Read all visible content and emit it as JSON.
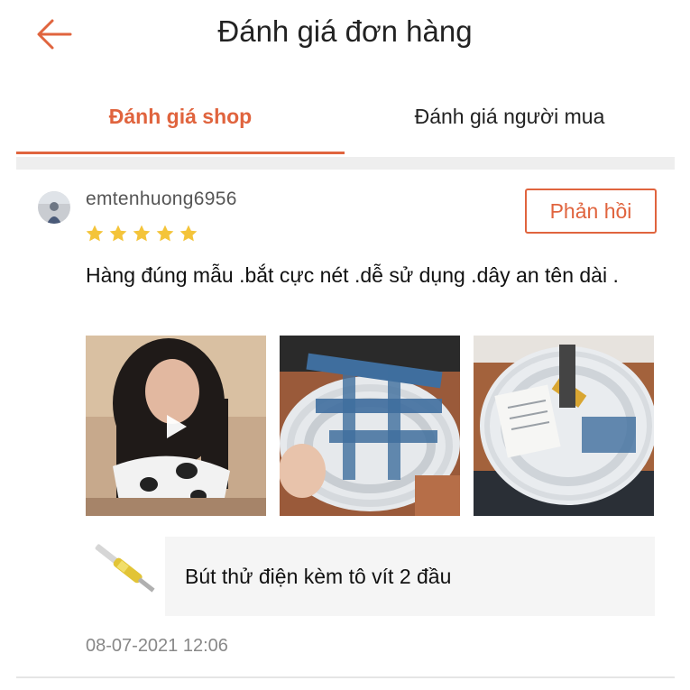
{
  "header": {
    "title": "Đánh giá đơn hàng",
    "back_icon": "arrow-left-icon",
    "accent_color": "#e0643e"
  },
  "tabs": [
    {
      "label": "Đánh giá shop",
      "active": true
    },
    {
      "label": "Đánh giá người mua",
      "active": false
    }
  ],
  "review": {
    "username": "emtenhuong6956",
    "rating": 5,
    "max_rating": 5,
    "reply_label": "Phản hồi",
    "text": "Hàng đúng mẫu .bắt cực nét .dễ sử dụng .dây an tên dài .",
    "media": [
      {
        "kind": "video",
        "icon": "play-icon"
      },
      {
        "kind": "photo"
      },
      {
        "kind": "photo"
      }
    ],
    "product": {
      "name": "Bút thử điện kèm tô vít 2 đầu"
    },
    "timestamp": "08-07-2021 12:06"
  }
}
